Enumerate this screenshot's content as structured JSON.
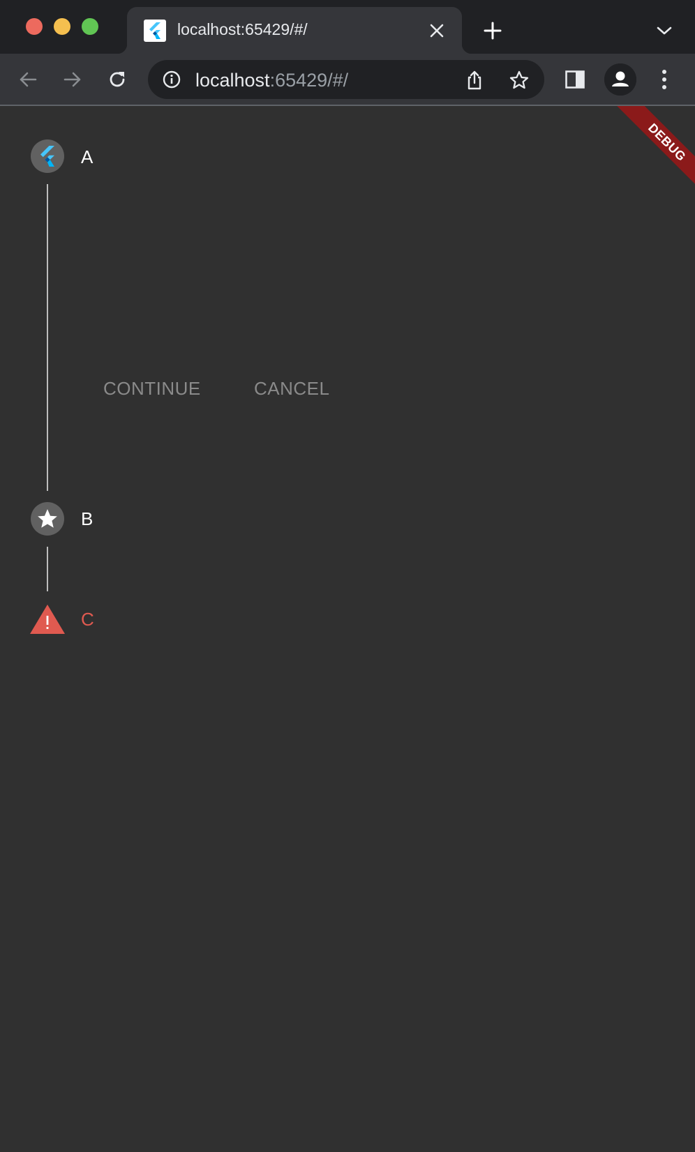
{
  "browser": {
    "tab": {
      "title": "localhost:65429/#/",
      "favicon": "flutter-icon",
      "close_icon": "close-icon"
    },
    "new_tab_icon": "plus-icon",
    "tab_search_icon": "chevron-down-icon",
    "toolbar": {
      "back_icon": "arrow-left-icon",
      "forward_icon": "arrow-right-icon",
      "reload_icon": "reload-icon",
      "site_info_icon": "info-icon",
      "url_host": "localhost",
      "url_rest": ":65429/#/",
      "share_icon": "share-icon",
      "bookmark_icon": "star-outline-icon",
      "side_panel_icon": "side-panel-icon",
      "profile_icon": "person-icon",
      "menu_icon": "kebab-menu-icon"
    }
  },
  "app": {
    "debug_banner": "DEBUG",
    "stepper": {
      "steps": [
        {
          "label": "A",
          "icon": "flutter-icon",
          "state": "active"
        },
        {
          "label": "B",
          "icon": "star-icon",
          "state": "indexed"
        },
        {
          "label": "C",
          "icon": "warning-icon",
          "state": "error"
        }
      ],
      "controls": {
        "continue_label": "CONTINUE",
        "cancel_label": "CANCEL"
      }
    },
    "colors": {
      "background": "#303030",
      "step_circle": "#616161",
      "error": "#e05a50",
      "debug_banner": "#8b1a1a"
    }
  }
}
